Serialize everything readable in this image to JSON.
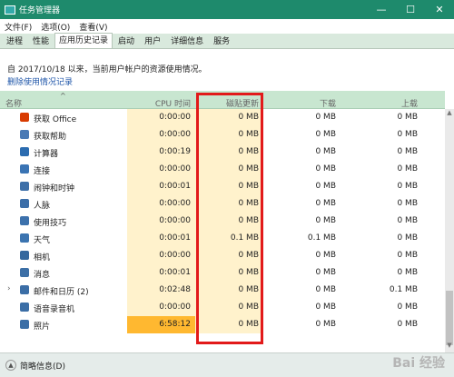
{
  "window": {
    "title": "任务管理器"
  },
  "window_controls": [
    "—",
    "☐",
    "✕"
  ],
  "menu": [
    "文件(F)",
    "选项(O)",
    "查看(V)"
  ],
  "tabs": [
    {
      "label": "进程",
      "active": false
    },
    {
      "label": "性能",
      "active": false
    },
    {
      "label": "应用历史记录",
      "active": true
    },
    {
      "label": "启动",
      "active": false
    },
    {
      "label": "用户",
      "active": false
    },
    {
      "label": "详细信息",
      "active": false
    },
    {
      "label": "服务",
      "active": false
    }
  ],
  "info_text": "自 2017/10/18 以来，当前用户帐户的资源使用情况。",
  "delete_link": "删除使用情况记录",
  "columns": {
    "name": "名称",
    "cpu": "CPU 时间",
    "tile": "磁贴更新",
    "download": "下载",
    "upload": "上载"
  },
  "sort_indicator": "^",
  "rows": [
    {
      "name": "获取 Office",
      "icon": "office-icon",
      "icon_color": "#d83b01",
      "expand": false,
      "cpu": "0:00:00",
      "tile": "0 MB",
      "download": "0 MB",
      "upload": "0 MB",
      "cpu_heat": 0
    },
    {
      "name": "获取帮助",
      "icon": "help-icon",
      "icon_color": "#4a7ab5",
      "expand": false,
      "cpu": "0:00:00",
      "tile": "0 MB",
      "download": "0 MB",
      "upload": "0 MB",
      "cpu_heat": 0
    },
    {
      "name": "计算器",
      "icon": "calculator-icon",
      "icon_color": "#2b6cb0",
      "expand": false,
      "cpu": "0:00:19",
      "tile": "0 MB",
      "download": "0 MB",
      "upload": "0 MB",
      "cpu_heat": 0
    },
    {
      "name": "连接",
      "icon": "connect-icon",
      "icon_color": "#3a74b4",
      "expand": false,
      "cpu": "0:00:00",
      "tile": "0 MB",
      "download": "0 MB",
      "upload": "0 MB",
      "cpu_heat": 0
    },
    {
      "name": "闹钟和时钟",
      "icon": "alarm-clock-icon",
      "icon_color": "#3d6fa8",
      "expand": false,
      "cpu": "0:00:01",
      "tile": "0 MB",
      "download": "0 MB",
      "upload": "0 MB",
      "cpu_heat": 0
    },
    {
      "name": "人脉",
      "icon": "people-icon",
      "icon_color": "#3b6ea8",
      "expand": false,
      "cpu": "0:00:00",
      "tile": "0 MB",
      "download": "0 MB",
      "upload": "0 MB",
      "cpu_heat": 0
    },
    {
      "name": "使用技巧",
      "icon": "tips-icon",
      "icon_color": "#3c71ac",
      "expand": false,
      "cpu": "0:00:00",
      "tile": "0 MB",
      "download": "0 MB",
      "upload": "0 MB",
      "cpu_heat": 0
    },
    {
      "name": "天气",
      "icon": "weather-icon",
      "icon_color": "#3b74b0",
      "expand": false,
      "cpu": "0:00:01",
      "tile": "0.1 MB",
      "download": "0.1 MB",
      "upload": "0 MB",
      "cpu_heat": 0
    },
    {
      "name": "相机",
      "icon": "camera-icon",
      "icon_color": "#36689e",
      "expand": false,
      "cpu": "0:00:00",
      "tile": "0 MB",
      "download": "0 MB",
      "upload": "0 MB",
      "cpu_heat": 0
    },
    {
      "name": "消息",
      "icon": "messaging-icon",
      "icon_color": "#3c6fa6",
      "expand": false,
      "cpu": "0:00:01",
      "tile": "0 MB",
      "download": "0 MB",
      "upload": "0 MB",
      "cpu_heat": 0
    },
    {
      "name": "邮件和日历 (2)",
      "icon": "mail-calendar-icon",
      "icon_color": "#3b6ea6",
      "expand": true,
      "cpu": "0:02:48",
      "tile": "0 MB",
      "download": "0 MB",
      "upload": "0.1 MB",
      "cpu_heat": 0
    },
    {
      "name": "语音录音机",
      "icon": "voice-recorder-icon",
      "icon_color": "#3b6ea6",
      "expand": false,
      "cpu": "0:00:00",
      "tile": "0 MB",
      "download": "0 MB",
      "upload": "0 MB",
      "cpu_heat": 0
    },
    {
      "name": "照片",
      "icon": "photos-icon",
      "icon_color": "#3b6ea6",
      "expand": false,
      "cpu": "6:58:12",
      "tile": "0 MB",
      "download": "0 MB",
      "upload": "0 MB",
      "cpu_heat": 1
    }
  ],
  "footer": {
    "label": "简略信息(D)",
    "icon": "chevron-up-icon"
  },
  "watermark": "Bai 经验",
  "colors": {
    "titlebar": "#1e8a6c",
    "header_bg": "#c8e6d0",
    "cpu_cell": "#fff2cc",
    "cpu_cell_hot": "#ffb830",
    "highlight_box": "#e21a1a"
  }
}
